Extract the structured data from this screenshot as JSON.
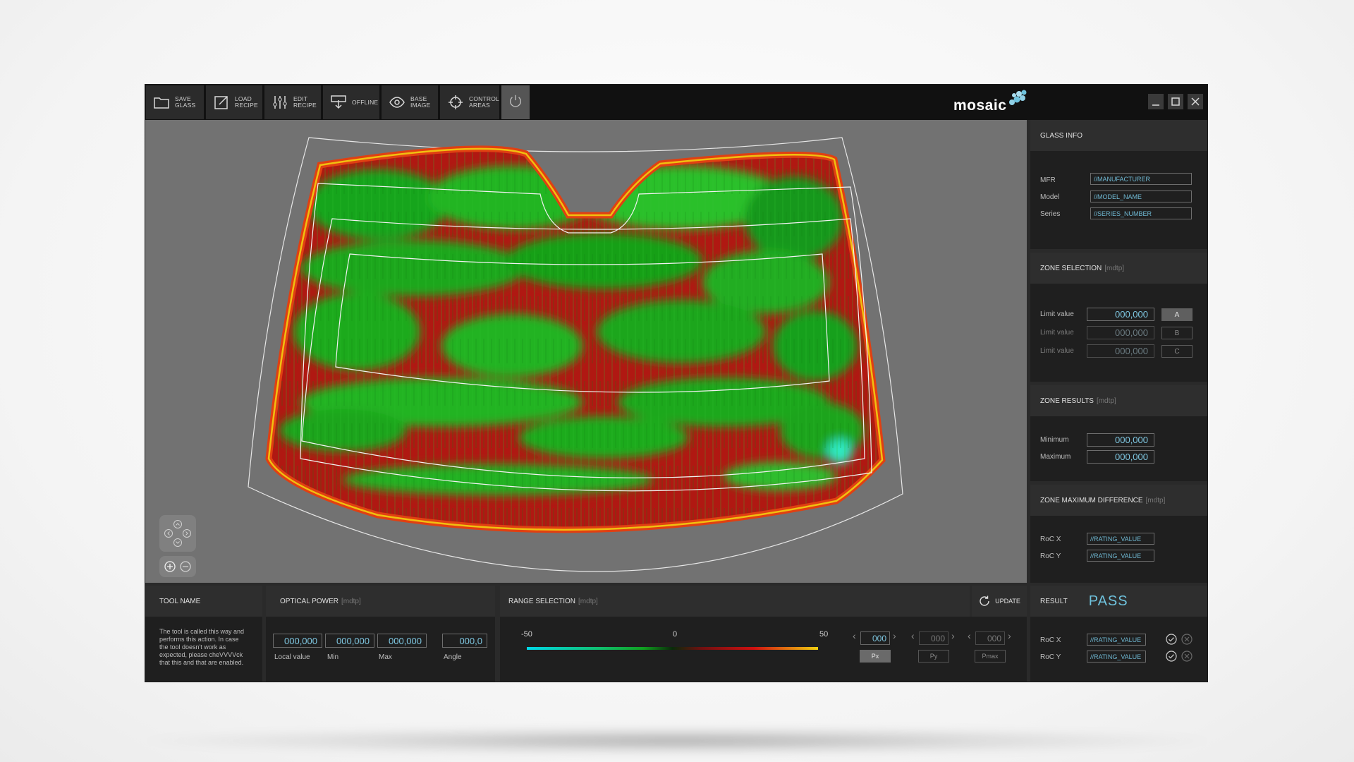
{
  "toolbar": {
    "buttons": [
      {
        "label": "SAVE GLASS",
        "icon": "folder-icon"
      },
      {
        "label": "LOAD RECIPE",
        "icon": "edit-square-icon"
      },
      {
        "label": "EDIT RECIPE",
        "icon": "sliders-icon"
      },
      {
        "label": "OFFLINE",
        "icon": "offline-icon"
      },
      {
        "label": "BASE IMAGE",
        "icon": "eye-icon"
      },
      {
        "label": "CONTROL AREAS",
        "icon": "crosshair-icon"
      }
    ],
    "power_icon": "power-icon",
    "logo": "mosaic",
    "window_controls": [
      "minimize-icon",
      "maximize-icon",
      "close-icon"
    ]
  },
  "glass_info": {
    "title": "GLASS INFO",
    "rows": [
      {
        "label": "MFR",
        "value": "//MANUFACTURER"
      },
      {
        "label": "Model",
        "value": "//MODEL_NAME"
      },
      {
        "label": "Series",
        "value": "//SERIES_NUMBER"
      }
    ]
  },
  "zone_selection": {
    "title": "ZONE SELECTION",
    "unit": "[mdtp]",
    "rows": [
      {
        "label": "Limit value",
        "value": "000,000",
        "zone": "A"
      },
      {
        "label": "Limit value",
        "value": "000,000",
        "zone": "B"
      },
      {
        "label": "Limit value",
        "value": "000,000",
        "zone": "C"
      }
    ],
    "active_zone": "A"
  },
  "zone_results": {
    "title": "ZONE RESULTS",
    "unit": "[mdtp]",
    "rows": [
      {
        "label": "Minimum",
        "value": "000,000"
      },
      {
        "label": "Maximum",
        "value": "000,000"
      }
    ]
  },
  "zone_max_diff": {
    "title": "ZONE MAXIMUM DIFFERENCE",
    "unit": "[mdtp]",
    "rows": [
      {
        "label": "RoC X",
        "value": "//RATING_VALUE"
      },
      {
        "label": "RoC Y",
        "value": "//RATING_VALUE"
      }
    ]
  },
  "tool_name": {
    "title": "TOOL NAME",
    "description": "The tool is called this way and performs this action. In case the tool doesn't work as expected, please cheVVVVck that this and that are enabled."
  },
  "optical_power": {
    "title": "OPTICAL POWER",
    "unit": "[mdtp]",
    "values": [
      "000,000",
      "000,000",
      "000,000",
      "000,0"
    ],
    "captions": [
      "Local value",
      "Min",
      "Max",
      "Angle"
    ]
  },
  "range_selection": {
    "title": "RANGE SELECTION",
    "unit": "[mdtp]",
    "scale_min": "-50",
    "scale_mid": "0",
    "scale_max": "50",
    "params": [
      {
        "value": "000",
        "label": "Px"
      },
      {
        "value": "000",
        "label": "Py"
      },
      {
        "value": "000",
        "label": "Pmax"
      }
    ],
    "active_param": "Px",
    "update_label": "UPDATE"
  },
  "result": {
    "title": "RESULT",
    "value": "PASS",
    "rows": [
      {
        "label": "RoC X",
        "value": "//RATING_VALUE"
      },
      {
        "label": "RoC Y",
        "value": "//RATING_VALUE"
      }
    ]
  },
  "colors": {
    "accent": "#6fc3de",
    "heat_green": "#1faa1f",
    "heat_red": "#c8140f",
    "heat_yellow": "#f0d010"
  }
}
